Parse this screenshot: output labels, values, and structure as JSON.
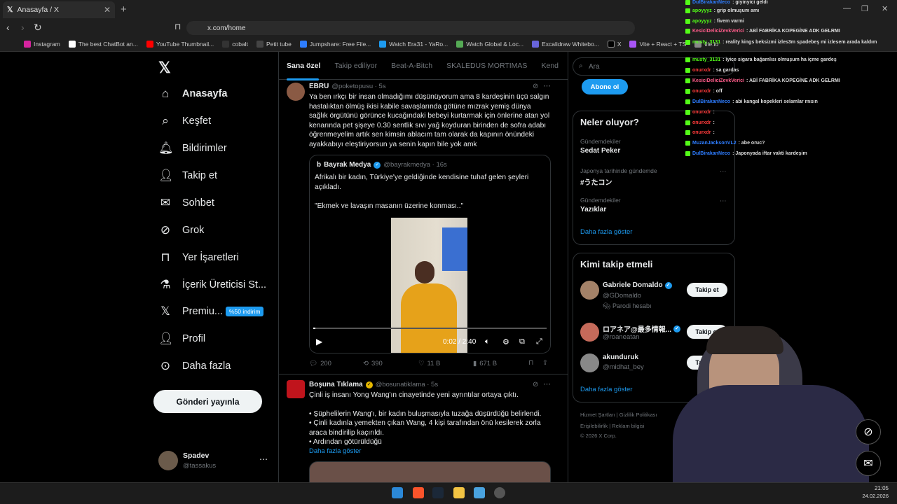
{
  "browser": {
    "tab_title": "Anasayfa / X",
    "url": "x.com/home",
    "bookmarks": [
      "Instagram",
      "The best ChatBot an...",
      "YouTube Thumbnail...",
      "cobalt",
      "Petit tube",
      "Jumpshare: Free File...",
      "Watch Era31 - YaRo...",
      "Watch Global & Loc...",
      "Excalidraw Whitebo...",
      "X",
      "Vite + React + TS",
      "file.io"
    ]
  },
  "nav": {
    "items": [
      "Anasayfa",
      "Keşfet",
      "Bildirimler",
      "Takip et",
      "Sohbet",
      "Grok",
      "Yer İşaretleri",
      "İçerik Üreticisi St...",
      "Premiu...",
      "Profil",
      "Daha fazla"
    ],
    "premium_badge": "%50 indirim",
    "post_button": "Gönderi yayınla",
    "account_name": "Spadev",
    "account_handle": "@tassakus"
  },
  "timeline": {
    "tabs": [
      "Sana özel",
      "Takip ediliyor",
      "Beat-A-Bitch",
      "SKALEDUS MORTIMAS",
      "Kend"
    ],
    "tweet1": {
      "name": "EBRU",
      "handle": "@poketopusu · 5s",
      "text": "Ya ben ırkçı bir insan olmadığımı düşünüyorum ama 8 kardeşinin üçü salgın hastalıktan ölmüş ikisi kabile savaşlarında götüne mızrak yemiş dünya sağlık örgütünü görünce kucağındaki bebeyi kurtarmak için önlerine atan yol kenarında pet şişeye 0.30 sentlik sıvı yağ koyduran birinden de sofra adabı öğrenmeyelim artık sen kimsin ablacım tam olarak da kapının önündeki ayakkabıyı eleştiriyorsun ya senin kapın bile yok amk",
      "quote_name": "Bayrak Medya",
      "quote_handle": "@bayrakmedya · 16s",
      "quote_text1": "Afrikalı bir kadın, Türkiye'ye geldiğinde kendisine tuhaf gelen şeyleri açıkladı.",
      "quote_text2": "\"Ekmek ve lavaşın masanın üzerine konması..\"",
      "video_time": "0:02 / 2:40",
      "replies": "200",
      "reposts": "390",
      "likes": "11 B",
      "views": "671 B"
    },
    "tweet2": {
      "name": "Boşuna Tıklama",
      "handle": "@bosunatiklama · 5s",
      "line1": "Çinli iş insanı Yong Wang'ın cinayetinde yeni ayrıntılar ortaya çıktı.",
      "line2": "• Şüphelilerin Wang'ı, bir kadın buluşmasıyla tuzağa düşürdüğü belirlendi.",
      "line3": "• Çinli kadınla yemekten çıkan Wang, 4 kişi tarafından önü kesilerek zorla araca bindirilip kaçırıldı.",
      "line4": "• Ardından götürüldüğü",
      "more": "Daha fazla göster"
    }
  },
  "sidebar": {
    "search_placeholder": "Ara",
    "subscribe": "Abone ol",
    "trends_title": "Neler oluyor?",
    "trends": [
      {
        "cat": "Gündemdekiler",
        "name": "Sedat Peker"
      },
      {
        "cat": "Japonya tarihinde gündemde",
        "name": "#うたコン"
      },
      {
        "cat": "Gündemdekiler",
        "name": "Yazıklar"
      }
    ],
    "trends_more": "Daha fazla göster",
    "follow_title": "Kimi takip etmeli",
    "follow": [
      {
        "name": "Gabriele Domaldo",
        "handle": "@GDomaldo",
        "note": "Parodi hesabı",
        "btn": "Takip et"
      },
      {
        "name": "ロアネア@最多情報...",
        "handle": "@roaneatan",
        "btn": "Takip et"
      },
      {
        "name": "akunduruk",
        "handle": "@midhat_bey",
        "btn": "Takip et"
      }
    ],
    "follow_more": "Daha fazla göster",
    "footer1": "Hizmet Şartları   |   Gizlilik Politikası",
    "footer2": "Erişilebilirlik   |   Reklam bilgisi",
    "footer3": "© 2026 X Corp."
  },
  "chat": [
    {
      "u": "DulBirakanNeco",
      "m": ": giyinyici geldi",
      "c": "#2e7dff"
    },
    {
      "u": "apoyyyz",
      "m": ": grip olmuşum amı",
      "c": "#53fc18"
    },
    {
      "u": "apoyyyz",
      "m": ": fivem varmi",
      "c": "#53fc18"
    },
    {
      "u": "KesiciDeliciZevkVerici",
      "m": ": ABİ FABRİKA KOPEGİNE ADK GELRMI",
      "c": "#ff5c8a"
    },
    {
      "u": "musty_3131",
      "m": ": reality kings beksizmi izles3m spadebeş mi izlesem arada kaldım",
      "c": "#53fc18"
    },
    {
      "u": "musty_3131",
      "m": ": iyice sigara bağamlısı olmuşum ha içme gardeş",
      "c": "#53fc18"
    },
    {
      "u": "onurxdr",
      "m": ": sa gardas",
      "c": "#ff3b3b"
    },
    {
      "u": "KesiciDeliciZevkVerici",
      "m": ": ABİ FABRİKA KOPEGİNE ADK GELRMI",
      "c": "#ff5c8a"
    },
    {
      "u": "onurxdr",
      "m": ": off",
      "c": "#ff3b3b"
    },
    {
      "u": "DulBirakanNeco",
      "m": ": abi kangal kopekleri selamlar mısın",
      "c": "#2e7dff"
    },
    {
      "u": "onurxdr",
      "m": ":",
      "c": "#ff3b3b"
    },
    {
      "u": "onurxdr",
      "m": ":",
      "c": "#ff3b3b"
    },
    {
      "u": "onurxdr",
      "m": ":",
      "c": "#ff3b3b"
    },
    {
      "u": "MuzanJacksonVL2",
      "m": ": abe oruc?",
      "c": "#2e7dff"
    },
    {
      "u": "DulBirakanNeco",
      "m": ": Japonyada iftar vakti kardeşim",
      "c": "#2e7dff"
    }
  ],
  "taskbar": {
    "time": "21:05",
    "date": "24.02.2026"
  }
}
